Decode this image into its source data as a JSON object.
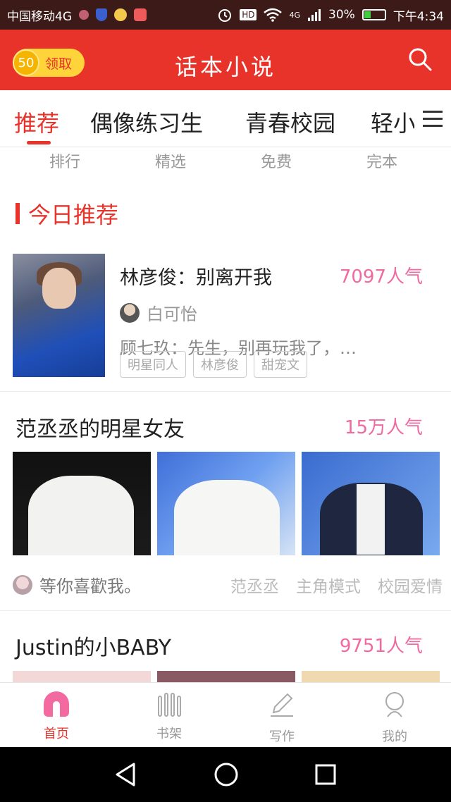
{
  "status_bar": {
    "carrier": "中国移动4G",
    "network": "4G",
    "battery_percent": "30%",
    "battery_level": 0.3,
    "time": "下午4:34"
  },
  "app_bar": {
    "coin_count": "50",
    "coin_label": "领取",
    "title": "话本小说"
  },
  "tabs": [
    "推荐",
    "偶像练习生",
    "青春校园",
    "轻小"
  ],
  "subnav": [
    "排行",
    "精选",
    "免费",
    "完本"
  ],
  "today_section": {
    "title": "今日推荐"
  },
  "featured_book": {
    "title": "林彦俊：别离开我",
    "popularity": "7097人气",
    "author": "白可怡",
    "description": "顾七玖：先生，别再玩我了，…",
    "tags": [
      "明星同人",
      "林彦俊",
      "甜宠文"
    ]
  },
  "block1": {
    "title": "范丞丞的明星女友",
    "popularity": "15万人气",
    "author": "等你喜歡我。",
    "tags": [
      "范丞丞",
      "主角模式",
      "校园爱情"
    ]
  },
  "block2": {
    "title": "Justin的小BABY",
    "popularity": "9751人气"
  },
  "bottom_nav": [
    {
      "label": "首页",
      "icon": "home-icon",
      "active": true
    },
    {
      "label": "书架",
      "icon": "bookshelf-icon",
      "active": false
    },
    {
      "label": "写作",
      "icon": "pen-icon",
      "active": false
    },
    {
      "label": "我的",
      "icon": "profile-icon",
      "active": false
    }
  ],
  "colors": {
    "brand": "#e8332a",
    "popularity": "#f06aa0",
    "home_icon": "#f26aa0"
  }
}
